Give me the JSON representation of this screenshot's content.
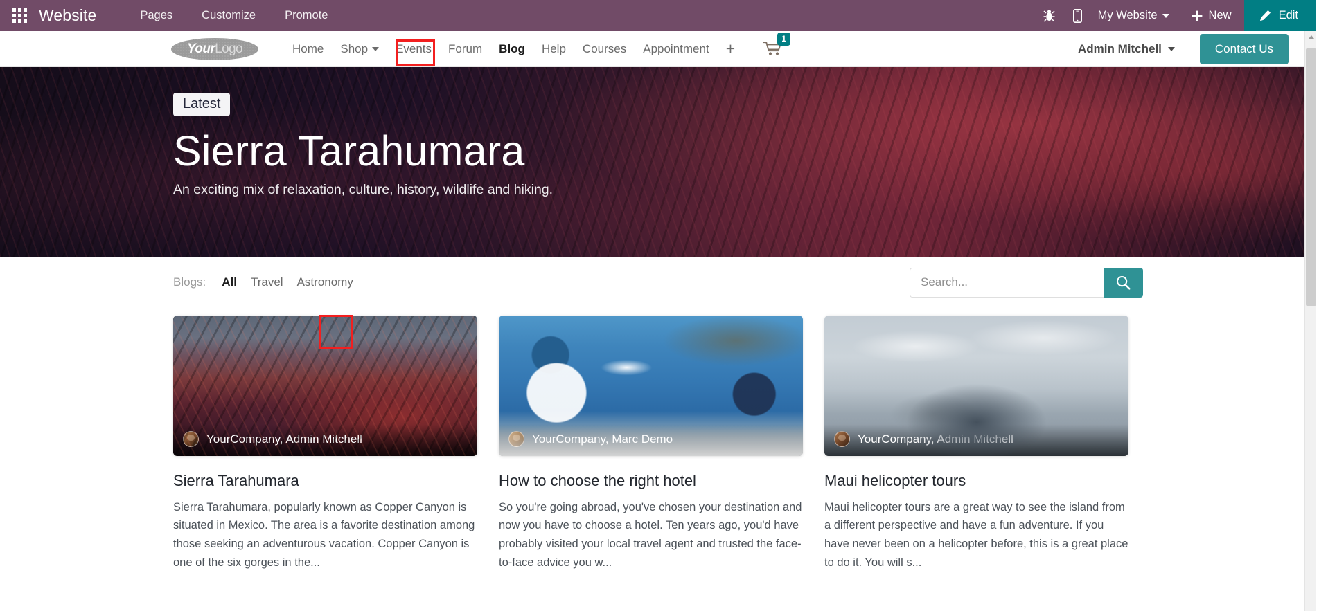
{
  "topbar": {
    "apps_icon": "apps-grid-icon",
    "brand": "Website",
    "menu": [
      {
        "label": "Pages"
      },
      {
        "label": "Customize"
      },
      {
        "label": "Promote"
      }
    ],
    "debug_icon": "bug-icon",
    "mobile_icon": "mobile-preview-icon",
    "website_selector": "My Website",
    "new_label": "New",
    "new_icon": "plus-icon",
    "edit_label": "Edit",
    "edit_icon": "pencil-icon",
    "bg_color": "#714B67",
    "edit_bg_color": "#017E84"
  },
  "site_header": {
    "logo": {
      "primary": "Your",
      "secondary": "Logo"
    },
    "nav": [
      {
        "label": "Home",
        "has_dropdown": false,
        "highlighted": false
      },
      {
        "label": "Shop",
        "has_dropdown": true,
        "highlighted": false
      },
      {
        "label": "Events",
        "has_dropdown": false,
        "highlighted": false
      },
      {
        "label": "Forum",
        "has_dropdown": false,
        "highlighted": false
      },
      {
        "label": "Blog",
        "has_dropdown": false,
        "highlighted": true
      },
      {
        "label": "Help",
        "has_dropdown": false,
        "highlighted": false
      },
      {
        "label": "Courses",
        "has_dropdown": false,
        "highlighted": false
      },
      {
        "label": "Appointment",
        "has_dropdown": false,
        "highlighted": false
      }
    ],
    "add_page_icon": "plus-icon",
    "cart": {
      "icon": "shopping-cart-icon",
      "count": "1",
      "badge_color": "#017E84"
    },
    "user_name": "Admin Mitchell",
    "contact_button": "Contact Us",
    "contact_button_color": "#2F9295"
  },
  "hero": {
    "badge": "Latest",
    "title": "Sierra Tarahumara",
    "subtitle": "An exciting mix of relaxation, culture, history, wildlife and hiking."
  },
  "filter_bar": {
    "label": "Blogs:",
    "items": [
      {
        "label": "All",
        "active": true,
        "highlighted": true
      },
      {
        "label": "Travel",
        "active": false,
        "highlighted": false
      },
      {
        "label": "Astronomy",
        "active": false,
        "highlighted": false
      }
    ],
    "search": {
      "value": "",
      "placeholder": "Search...",
      "button_icon": "search-icon",
      "button_color": "#2F9295"
    }
  },
  "blog_cards": [
    {
      "image_name": "sierra-tarahumara-mountains-photo",
      "credit": "YourCompany, Admin Mitchell",
      "avatar_name": "author-avatar-admin-mitchell",
      "title": "Sierra Tarahumara",
      "excerpt": "Sierra Tarahumara, popularly known as Copper Canyon is situated in Mexico. The area is a favorite destination among those seeking an adventurous vacation. Copper Canyon is one of the six gorges in the..."
    },
    {
      "image_name": "santorini-greece-seaside-photo",
      "credit": "YourCompany, Marc Demo",
      "avatar_name": "author-avatar-marc-demo",
      "title": "How to choose the right hotel",
      "excerpt": "So you're going abroad, you've chosen your destination and now you have to choose a hotel. Ten years ago, you'd have probably visited your local travel agent and trusted the face-to-face advice you w..."
    },
    {
      "image_name": "maui-island-aerial-photo",
      "credit": "YourCompany, Admin Mitchell",
      "avatar_name": "author-avatar-admin-mitchell",
      "title": "Maui helicopter tours",
      "excerpt": "Maui helicopter tours are a great way to see the island from a different perspective and have a fun adventure. If you have never been on a helicopter before, this is a great place to do it. You will s..."
    }
  ],
  "scrollbar": {
    "up_arrow_icon": "scroll-up-arrow-icon"
  }
}
